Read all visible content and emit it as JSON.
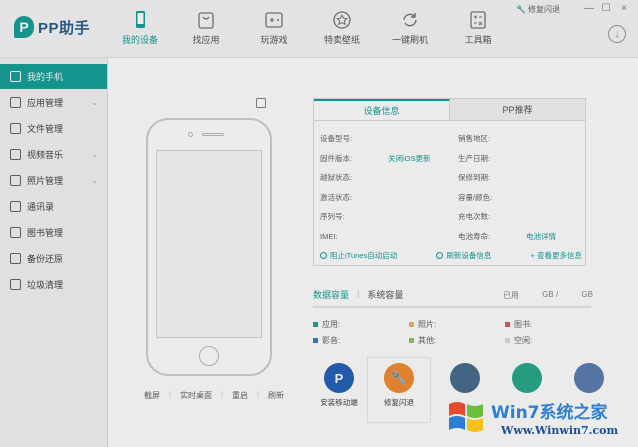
{
  "app": {
    "logo_text": "PP助手"
  },
  "nav": [
    {
      "label": "我的设备",
      "icon": "phone-icon"
    },
    {
      "label": "找应用",
      "icon": "bag-icon"
    },
    {
      "label": "玩游戏",
      "icon": "gamepad-icon"
    },
    {
      "label": "特卖壁纸",
      "icon": "star-icon"
    },
    {
      "label": "一键刷机",
      "icon": "refresh-icon"
    },
    {
      "label": "工具箱",
      "icon": "toolbox-icon"
    }
  ],
  "header": {
    "flash_link": "修复闪退",
    "min": "—",
    "max": "☐",
    "close": "×"
  },
  "sidebar": {
    "items": [
      {
        "label": "我的手机"
      },
      {
        "label": "应用管理"
      },
      {
        "label": "文件管理"
      },
      {
        "label": "视频音乐"
      },
      {
        "label": "照片管理"
      },
      {
        "label": "通讯录"
      },
      {
        "label": "图书管理"
      },
      {
        "label": "备份还原"
      },
      {
        "label": "垃圾清理"
      }
    ]
  },
  "phone_actions": [
    "截屏",
    "实时桌面",
    "重启",
    "刷新"
  ],
  "info": {
    "tab_device": "设备信息",
    "tab_pp": "PP推荐",
    "rows": [
      {
        "lk": "设备型号:",
        "lv": "",
        "rk": "销售地区:",
        "rv": ""
      },
      {
        "lk": "固件版本:",
        "lv": "关闭iOS更新",
        "rk": "生产日期:",
        "rv": ""
      },
      {
        "lk": "越狱状态:",
        "lv": "",
        "rk": "保修到期:",
        "rv": ""
      },
      {
        "lk": "激活状态:",
        "lv": "",
        "rk": "容量/颜色:",
        "rv": ""
      },
      {
        "lk": "序列号:",
        "lv": "",
        "rk": "充电次数:",
        "rv": ""
      },
      {
        "lk": "IMEI:",
        "lv": "",
        "rk": "电池寿命:",
        "rv": "电池详情"
      }
    ],
    "foot_left": "阻止iTunes自动启动",
    "foot_mid": "刷新设备信息",
    "foot_right": "+ 查看更多信息"
  },
  "storage": {
    "tab_data": "数据容量",
    "tab_system": "系统容量",
    "used": "已用",
    "gb1": "GB /",
    "gb2": "GB",
    "legend": [
      [
        {
          "label": "应用:",
          "color": "#1ba59b"
        },
        {
          "label": "照片:",
          "color": "#f0b460"
        },
        {
          "label": "图书:",
          "color": "#e05a5a"
        }
      ],
      [
        {
          "label": "影音:",
          "color": "#4a76c9"
        },
        {
          "label": "其他:",
          "color": "#8fc46b"
        },
        {
          "label": "空闲:",
          "color": "#dcdcdc"
        }
      ]
    ]
  },
  "apps": [
    {
      "label": "安装移动端",
      "color": "#2563b8",
      "glyph": "P"
    },
    {
      "label": "修复闪退",
      "color": "#f58c35",
      "glyph": "🔧"
    },
    {
      "label": "",
      "color": "#4a6d8f",
      "glyph": ""
    },
    {
      "label": "",
      "color": "#2aa98b",
      "glyph": ""
    },
    {
      "label": "",
      "color": "#5c7fb1",
      "glyph": ""
    }
  ],
  "watermark": {
    "title": "Win7系统之家",
    "url": "Www.Winwin7.com"
  }
}
